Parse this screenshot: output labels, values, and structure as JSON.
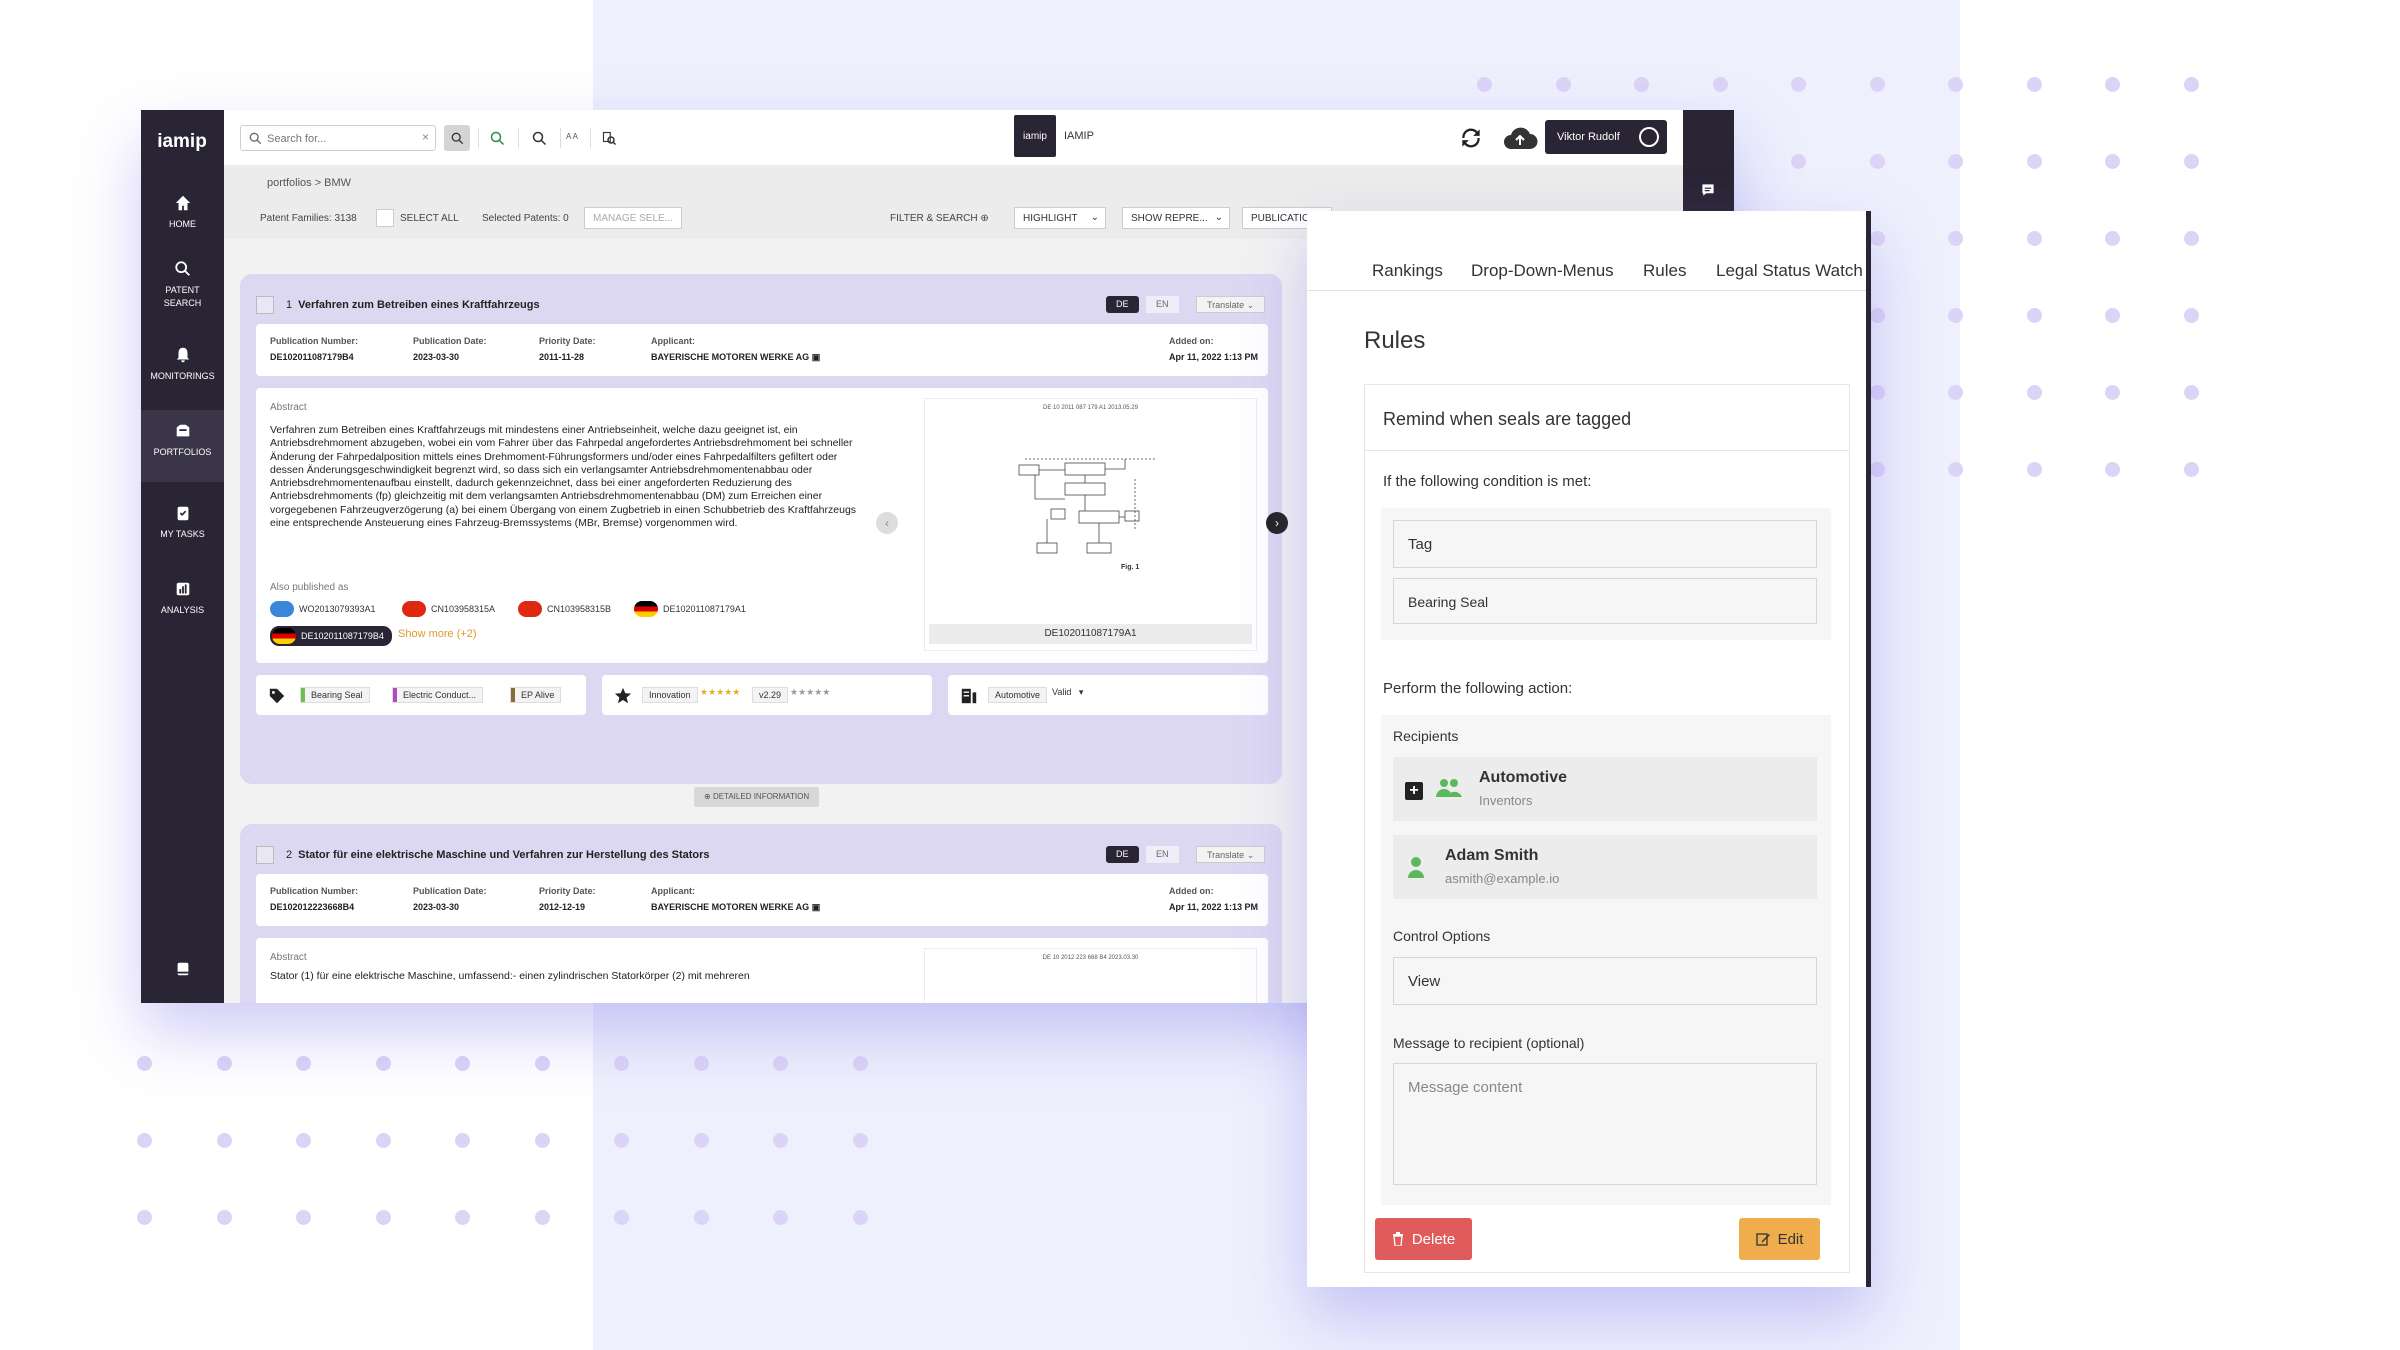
{
  "colors": {
    "accent_dark": "#2a2535",
    "lavender": "#ddd8f2",
    "orange": "#f0ad4e",
    "red": "#e05b5b",
    "green": "#5cb85c"
  },
  "nav": {
    "logo": "iamip",
    "items": [
      {
        "label": "HOME",
        "icon": "home-icon"
      },
      {
        "label": "PATENT SEARCH",
        "icon": "search-icon"
      },
      {
        "label": "MONITORINGS",
        "icon": "bell-icon"
      },
      {
        "label": "PORTFOLIOS",
        "icon": "folder-icon"
      },
      {
        "label": "MY TASKS",
        "icon": "clipboard-icon"
      },
      {
        "label": "ANALYSIS",
        "icon": "chart-icon"
      }
    ]
  },
  "topbar": {
    "search_placeholder": "Search for...",
    "brand_logo": "iamip",
    "brand_label": "IAMIP",
    "user": "Viktor Rudolf",
    "aa_label": "A A"
  },
  "breadcrumb": "portfolios > BMW",
  "subbar": {
    "patent_families": "Patent Families: 3138",
    "select_all": "SELECT ALL",
    "selected": "Selected Patents: 0",
    "manage": "MANAGE SELE...",
    "filter": "FILTER & SEARCH",
    "highlight": "HIGHLIGHT",
    "show_repre": "SHOW REPRE...",
    "publication": "PUBLICATIO"
  },
  "results": [
    {
      "num": "1",
      "title": "Verfahren zum Betreiben eines Kraftfahrzeugs",
      "lang_de": "DE",
      "lang_en": "EN",
      "translate": "Translate",
      "meta": {
        "pub_num_label": "Publication Number:",
        "pub_num": "DE102011087179B4",
        "pub_date_label": "Publication Date:",
        "pub_date": "2023-03-30",
        "prio_label": "Priority Date:",
        "prio": "2011-11-28",
        "applicant_label": "Applicant:",
        "applicant": "BAYERISCHE MOTOREN WERKE AG",
        "added_label": "Added on:",
        "added": "Apr 11, 2022 1:13 PM"
      },
      "abstract_label": "Abstract",
      "abstract": "Verfahren zum Betreiben eines Kraftfahrzeugs mit mindestens einer Antriebseinheit, welche dazu geeignet ist, ein Antriebsdrehmoment abzugeben, wobei ein vom Fahrer über das Fahrpedal angefordertes Antriebsdrehmoment bei schneller Änderung der Fahrpedalposition mittels eines Drehmoment-Führungsformers und/oder eines Fahrpedalfilters gefiltert oder dessen Änderungsgeschwindigkeit begrenzt wird, so dass sich ein verlangsamter Antriebsdrehmomentenabbau oder Antriebsdrehmomentenaufbau einstellt, dadurch gekennzeichnet, dass bei einer angeforderten Reduzierung des Antriebsdrehmoments (fp) gleichzeitig mit dem verlangsamten Antriebsdrehmomentenabbau (DM) zum Erreichen einer vorgegebenen Fahrzeugverzögerung (a) bei einem Übergang von einem Zugbetrieb in einen Schubbetrieb des Kraftfahrzeugs eine entsprechende Ansteuerung eines Fahrzeug-Bremssystems (MBr, Bremse) vorgenommen wird.",
      "also_label": "Also published as",
      "also": [
        "WO2013079393A1",
        "CN103958315A",
        "CN103958315B",
        "DE102011087179A1",
        "DE102011087179B4"
      ],
      "show_more": "Show more (+2)",
      "figure_caption": "DE102011087179A1",
      "figure_header": "DE 10 2011 087 179 A1 2013.05.29",
      "figure_label": "Fig. 1",
      "tags": [
        "Bearing Seal",
        "Electric Conduct...",
        "EP Alive"
      ],
      "ratings": {
        "innovation": "Innovation",
        "version": "v2.29"
      },
      "status": {
        "group": "Automotive",
        "value": "Valid"
      },
      "detail": "DETAILED INFORMATION"
    },
    {
      "num": "2",
      "title": "Stator für eine elektrische Maschine und Verfahren zur Herstellung des Stators",
      "lang_de": "DE",
      "lang_en": "EN",
      "translate": "Translate",
      "meta": {
        "pub_num_label": "Publication Number:",
        "pub_num": "DE102012223668B4",
        "pub_date_label": "Publication Date:",
        "pub_date": "2023-03-30",
        "prio_label": "Priority Date:",
        "prio": "2012-12-19",
        "applicant_label": "Applicant:",
        "applicant": "BAYERISCHE MOTOREN WERKE AG",
        "added_label": "Added on:",
        "added": "Apr 11, 2022 1:13 PM"
      },
      "abstract_label": "Abstract",
      "abstract": "Stator (1) für eine elektrische Maschine, umfassend:- einen zylindrischen Statorkörper (2) mit mehreren",
      "figure_header": "DE 10 2012 223 668 B4 2023.03.30"
    }
  ],
  "rules": {
    "tabs": [
      "Rankings",
      "Drop-Down-Menus",
      "Rules",
      "Legal Status Watch"
    ],
    "title": "Rules",
    "rule_name": "Remind when seals are tagged",
    "condition_label": "If the following condition is met:",
    "condition_field": "Tag",
    "condition_value": "Bearing Seal",
    "action_label": "Perform the following action:",
    "recipients_label": "Recipients",
    "recipients": [
      {
        "name": "Automotive",
        "sub": "Inventors",
        "icon": "group-icon"
      },
      {
        "name": "Adam Smith",
        "sub": "asmith@example.io",
        "icon": "user-icon"
      }
    ],
    "control_label": "Control Options",
    "control_value": "View",
    "message_label": "Message to recipient (optional)",
    "message_placeholder": "Message content",
    "delete": "Delete",
    "edit": "Edit"
  }
}
